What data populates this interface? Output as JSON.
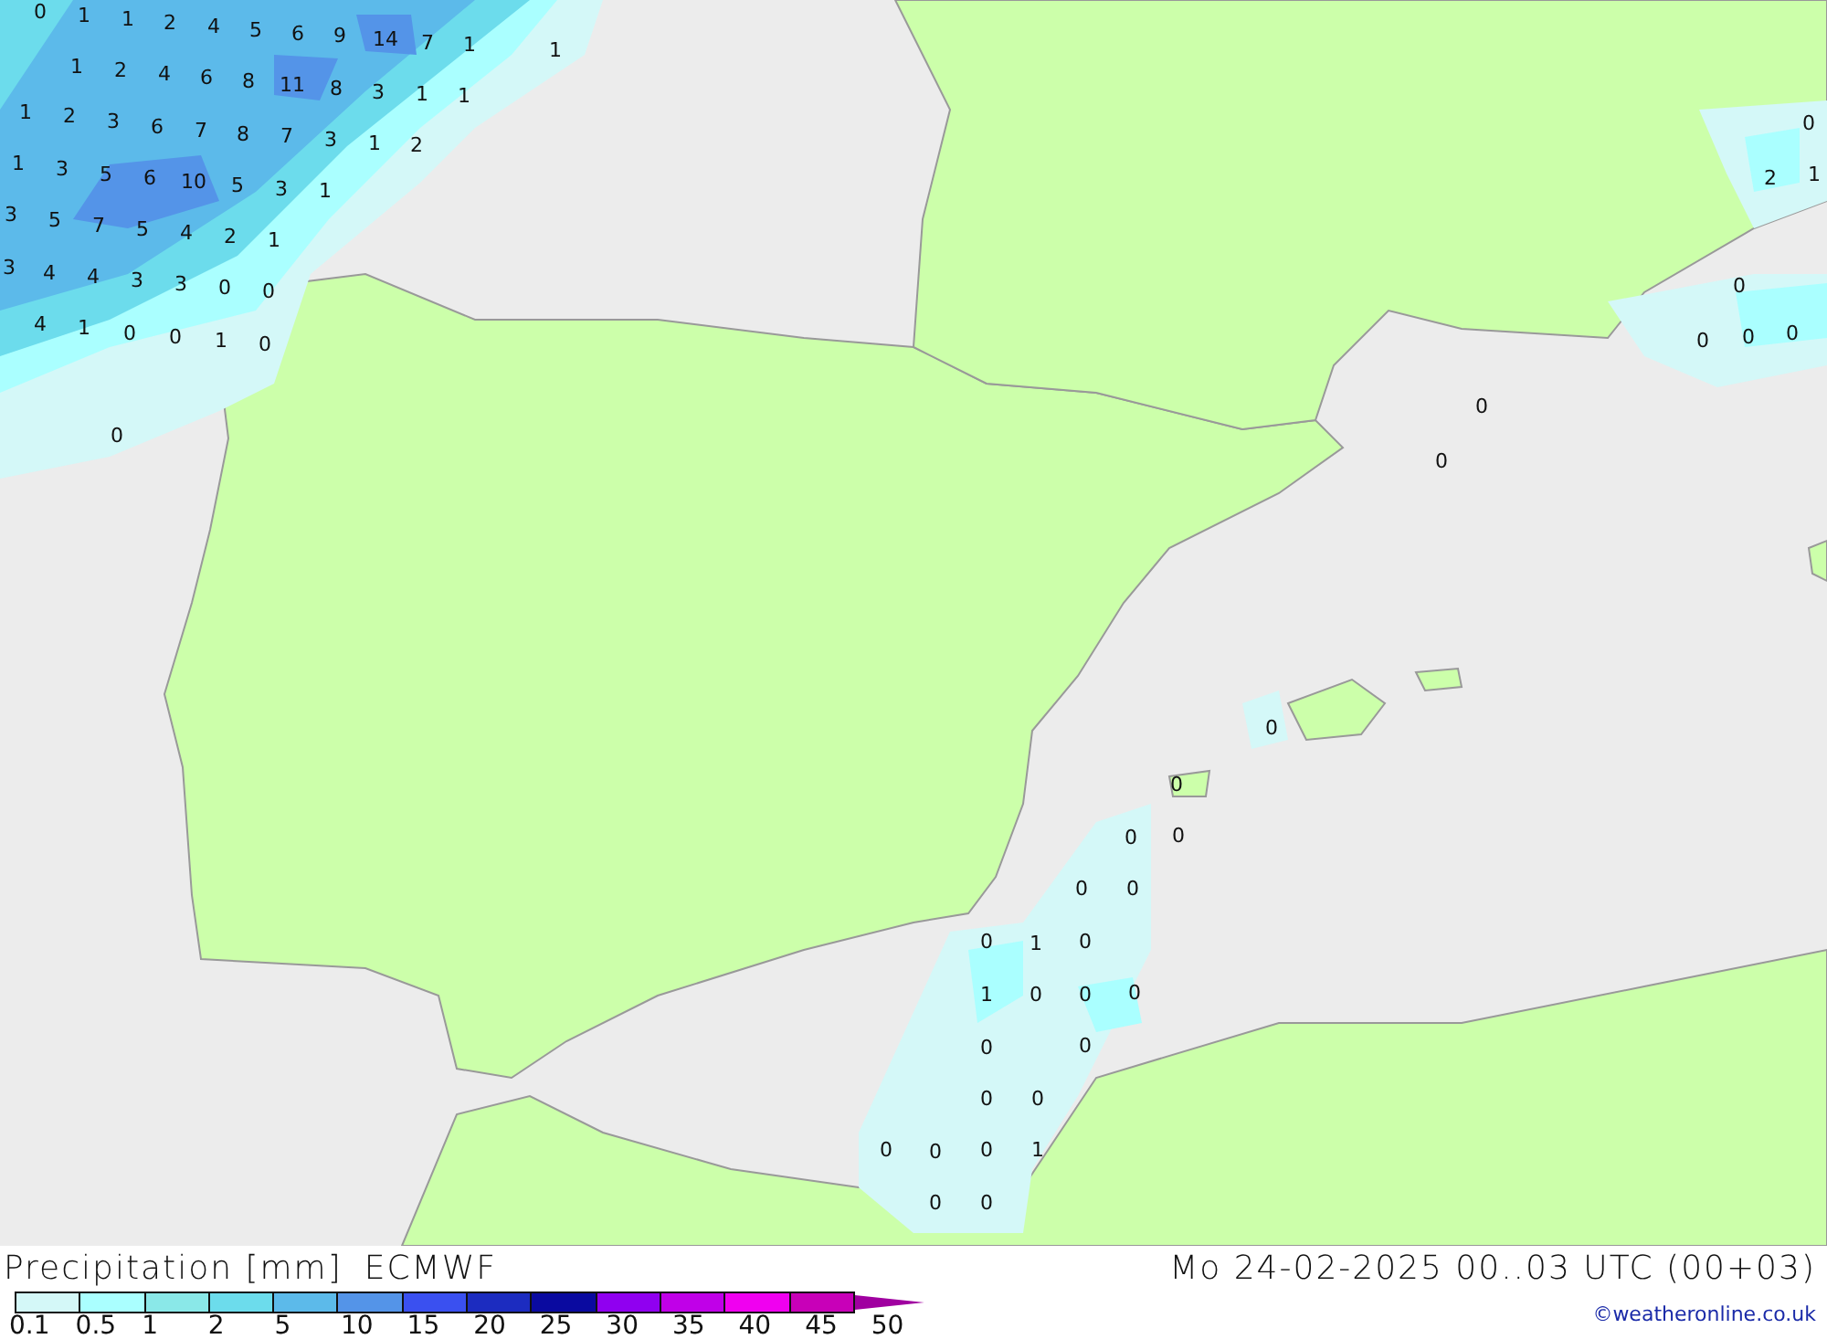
{
  "map": {
    "values": [
      "0",
      "1",
      "1",
      "2",
      "4",
      "5",
      "6",
      "9",
      "14",
      "7",
      "1",
      "1",
      "1",
      "2",
      "4",
      "6",
      "8",
      "11",
      "8",
      "3",
      "1",
      "1",
      "1",
      "2",
      "3",
      "6",
      "7",
      "8",
      "7",
      "3",
      "1",
      "2",
      "1",
      "3",
      "5",
      "6",
      "10",
      "5",
      "3",
      "1",
      "3",
      "5",
      "7",
      "5",
      "4",
      "2",
      "1",
      "3",
      "4",
      "4",
      "3",
      "3",
      "0",
      "0",
      "4",
      "1",
      "0",
      "0",
      "1",
      "0",
      "0",
      "0",
      "2",
      "1",
      "0",
      "0",
      "0",
      "0",
      "0",
      "0",
      "0",
      "0",
      "0",
      "0",
      "0",
      "0",
      "0",
      "1",
      "0",
      "1",
      "0",
      "0",
      "0",
      "0",
      "0",
      "0",
      "0",
      "0",
      "0",
      "0",
      "1",
      "0",
      "0"
    ]
  },
  "legend": {
    "title": "Precipitation [mm]",
    "model": "ECMWF",
    "bins": [
      {
        "kind": "box",
        "color": "#d4f8f8"
      },
      {
        "kind": "box",
        "color": "#aaffff"
      },
      {
        "kind": "box",
        "color": "#8ae8e8"
      },
      {
        "kind": "box",
        "color": "#6cdcec"
      },
      {
        "kind": "box",
        "color": "#5cbaea"
      },
      {
        "kind": "box",
        "color": "#5494e8"
      },
      {
        "kind": "box",
        "color": "#3a50f0"
      },
      {
        "kind": "box",
        "color": "#1c2cc0"
      },
      {
        "kind": "box",
        "color": "#0a0aa0"
      },
      {
        "kind": "box",
        "color": "#9000f0"
      },
      {
        "kind": "box",
        "color": "#c000e8"
      },
      {
        "kind": "box",
        "color": "#f000f0"
      },
      {
        "kind": "box",
        "color": "#c800b8"
      },
      {
        "kind": "arrow",
        "color": "#a000a0"
      }
    ],
    "ticks": [
      "0.1",
      "0.5",
      "1",
      "2",
      "5",
      "10",
      "15",
      "20",
      "25",
      "30",
      "35",
      "40",
      "45",
      "50"
    ]
  },
  "valid_time": "Mo 24-02-2025 00..03 UTC (00+03)",
  "credit": "©weatheronline.co.uk"
}
